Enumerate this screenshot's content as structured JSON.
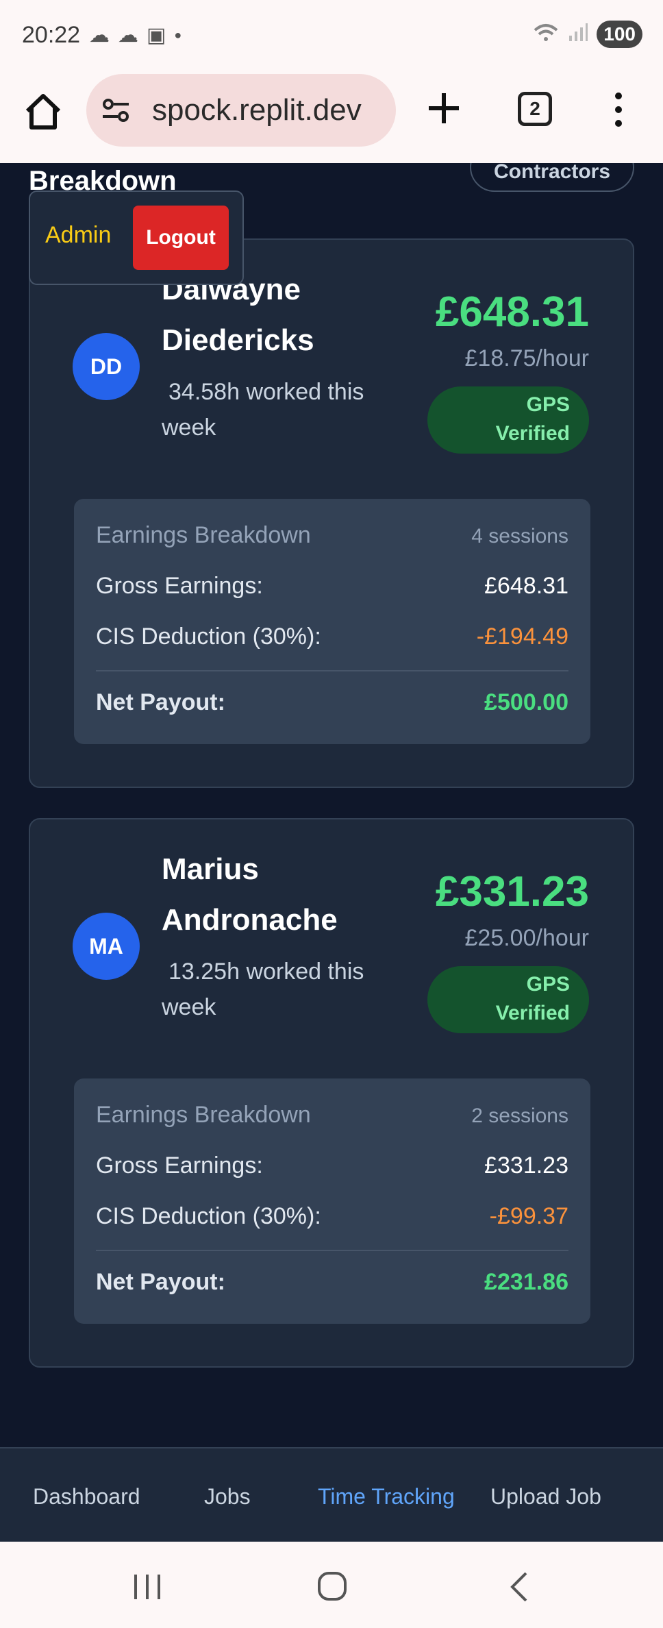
{
  "status_bar": {
    "time": "20:22",
    "battery": "100"
  },
  "browser": {
    "url": "spock.replit.dev",
    "tab_count": "2"
  },
  "page": {
    "section_title": "Breakdown",
    "contractors_button": "Contractors",
    "admin_label": "Admin",
    "logout_label": "Logout"
  },
  "contractors": [
    {
      "initials": "DD",
      "name_line1": "Dalwayne",
      "name_line2": "Diedericks",
      "hours_line1": "34.58h worked this",
      "hours_line2": "week",
      "amount": "£648.31",
      "rate": "£18.75/hour",
      "gps_line1": "GPS",
      "gps_line2": "Verified",
      "breakdown_title": "Earnings Breakdown",
      "sessions": "4 sessions",
      "gross_label": "Gross Earnings:",
      "gross_value": "£648.31",
      "cis_label": "CIS Deduction (30%):",
      "cis_value": "-£194.49",
      "net_label": "Net Payout:",
      "net_value": "£500.00"
    },
    {
      "initials": "MA",
      "name_line1": "Marius",
      "name_line2": "Andronache",
      "hours_line1": "13.25h worked this",
      "hours_line2": "week",
      "amount": "£331.23",
      "rate": "£25.00/hour",
      "gps_line1": "GPS",
      "gps_line2": "Verified",
      "breakdown_title": "Earnings Breakdown",
      "sessions": "2 sessions",
      "gross_label": "Gross Earnings:",
      "gross_value": "£331.23",
      "cis_label": "CIS Deduction (30%):",
      "cis_value": "-£99.37",
      "net_label": "Net Payout:",
      "net_value": "£231.86"
    }
  ],
  "nav": {
    "items": [
      "Dashboard",
      "Jobs",
      "Time Tracking",
      "Upload Job"
    ],
    "active": "Time Tracking"
  },
  "colors": {
    "background": "#0f172a",
    "card": "#1e293b",
    "accent_green": "#4ade80",
    "deduction_orange": "#fb923c",
    "logout_red": "#dc2626",
    "admin_yellow": "#facc15",
    "nav_active": "#60a5fa"
  }
}
